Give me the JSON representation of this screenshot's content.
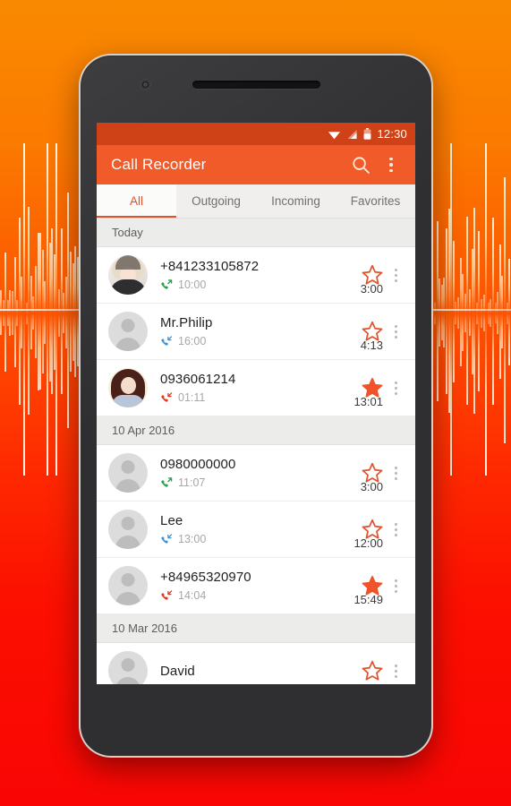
{
  "background": {
    "top_color": "#F98A00",
    "bottom_color": "#F90604",
    "waveform": "audio-waveform-graphic"
  },
  "device": {
    "name": "android-smartphone",
    "bezel_color": "#2f2f31"
  },
  "statusbar": {
    "time": "12:30",
    "icons": [
      "wifi-icon",
      "signal-icon",
      "battery-icon"
    ],
    "bg_color": "#cf4117"
  },
  "toolbar": {
    "title": "Call Recorder",
    "search_icon": "search-icon",
    "overflow_icon": "overflow-menu-icon",
    "bg_color": "#f15a29"
  },
  "tabs": {
    "active_index": 0,
    "accent_color": "#e2522a",
    "items": [
      {
        "label": "All"
      },
      {
        "label": "Outgoing"
      },
      {
        "label": "Incoming"
      },
      {
        "label": "Favorites"
      }
    ]
  },
  "call_list": [
    {
      "header": "Today",
      "rows": [
        {
          "name": "+841233105872",
          "call_type": "outgoing",
          "call_type_color": "#27a04a",
          "time": "10:00",
          "duration": "3:00",
          "favorite": false,
          "avatar": "photo-blonde-woman"
        },
        {
          "name": "Mr.Philip",
          "call_type": "incoming",
          "call_type_color": "#3d93d6",
          "time": "16:00",
          "duration": "4:13",
          "favorite": false,
          "avatar": "placeholder-person"
        },
        {
          "name": "0936061214",
          "call_type": "missed",
          "call_type_color": "#e8351d",
          "time": "01:11",
          "duration": "13:01",
          "favorite": true,
          "avatar": "photo-brunette-woman"
        }
      ]
    },
    {
      "header": "10 Apr 2016",
      "rows": [
        {
          "name": "0980000000",
          "call_type": "outgoing",
          "call_type_color": "#27a04a",
          "time": "11:07",
          "duration": "3:00",
          "favorite": false,
          "avatar": "placeholder-person"
        },
        {
          "name": "Lee",
          "call_type": "incoming",
          "call_type_color": "#3d93d6",
          "time": "13:00",
          "duration": "12:00",
          "favorite": false,
          "avatar": "placeholder-person"
        },
        {
          "name": "+84965320970",
          "call_type": "missed",
          "call_type_color": "#e8351d",
          "time": "14:04",
          "duration": "15:49",
          "favorite": true,
          "avatar": "placeholder-person"
        }
      ]
    },
    {
      "header": "10 Mar 2016",
      "rows": [
        {
          "name": "David",
          "call_type": "none",
          "call_type_color": "#27a04a",
          "time": "",
          "duration": "",
          "favorite": false,
          "avatar": "placeholder-person"
        }
      ]
    }
  ],
  "colors": {
    "star_outline": "#e2522a",
    "star_filled": "#f0532a"
  }
}
